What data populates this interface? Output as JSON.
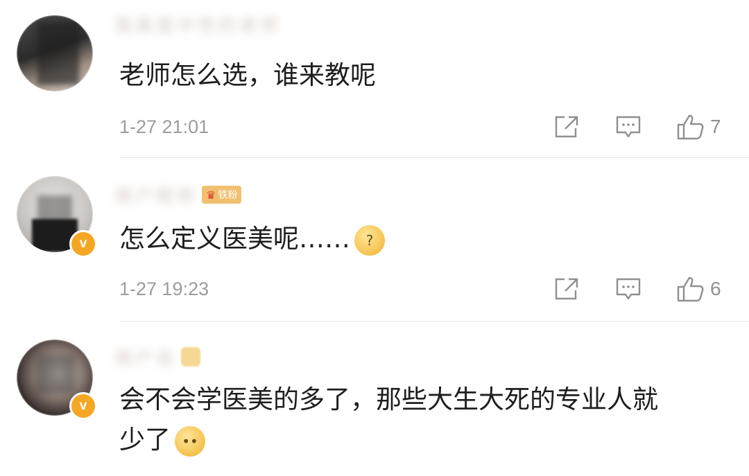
{
  "comments": [
    {
      "username": "我真是中性的老师",
      "text": "老师怎么选，谁来教呢",
      "time": "1-27 21:01",
      "likes": "7",
      "verified": false
    },
    {
      "username": "用户昵称",
      "fan_badge": "铁粉",
      "text": "怎么定义医美呢……",
      "emoji": "?",
      "time": "1-27 19:23",
      "likes": "6",
      "verified": true,
      "verified_label": "v"
    },
    {
      "username": "用户名",
      "text_line1": "会不会学医美的多了，那些大生大死的专业人就",
      "text_line2": "少了",
      "emoji": "••",
      "verified": true,
      "verified_label": "v"
    }
  ],
  "icons": {
    "share": "share-icon",
    "reply": "comment-icon",
    "like": "thumbs-up-icon"
  },
  "colors": {
    "badge": "#f5a623",
    "meta_text": "#9c9c9c",
    "divider": "#e6e6e6"
  }
}
